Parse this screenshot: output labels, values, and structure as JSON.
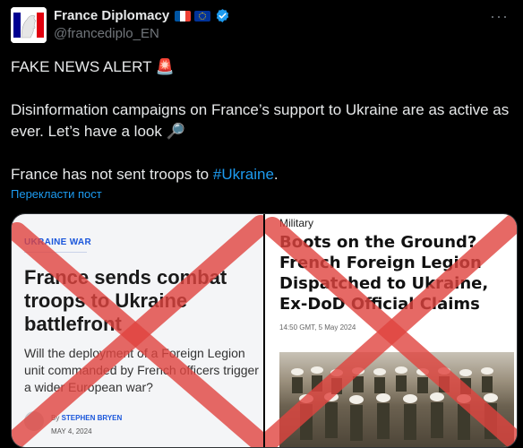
{
  "account": {
    "display_name": "France Diplomacy",
    "handle": "@francediplo_EN",
    "badges": [
      "france-flag",
      "eu-flag",
      "verified-badge"
    ],
    "verified_color": "#1d9bf0"
  },
  "tweet": {
    "line1": "FAKE NEWS ALERT 🚨",
    "line2": "Disinformation campaigns on France’s support to Ukraine are as active as ever. Let’s have a look 🔎",
    "line3_prefix": "France has not sent troops to ",
    "hashtag": "#Ukraine",
    "line3_suffix": ".",
    "translate_link": "Перекласти пост"
  },
  "media": {
    "left_card": {
      "kicker": "UKRAINE WAR",
      "headline": "France sends combat troops to Ukraine battlefront",
      "dek": "Will the deployment of a Foreign Legion unit commanded by French officers trigger a wider European war?",
      "byline_prefix": "By ",
      "author": "STEPHEN BRYEN",
      "date": "MAY 4, 2024"
    },
    "right_card": {
      "section": "Military",
      "headline": "Boots on the Ground? French Foreign Legion Dispatched to Ukraine, Ex-DoD Official Claims",
      "date": "14:50 GMT, 5 May 2024"
    },
    "cross_color": "#e0443e"
  },
  "colors": {
    "background": "#000000",
    "text": "#e7e9ea",
    "secondary": "#71767b",
    "link": "#1d9bf0"
  }
}
